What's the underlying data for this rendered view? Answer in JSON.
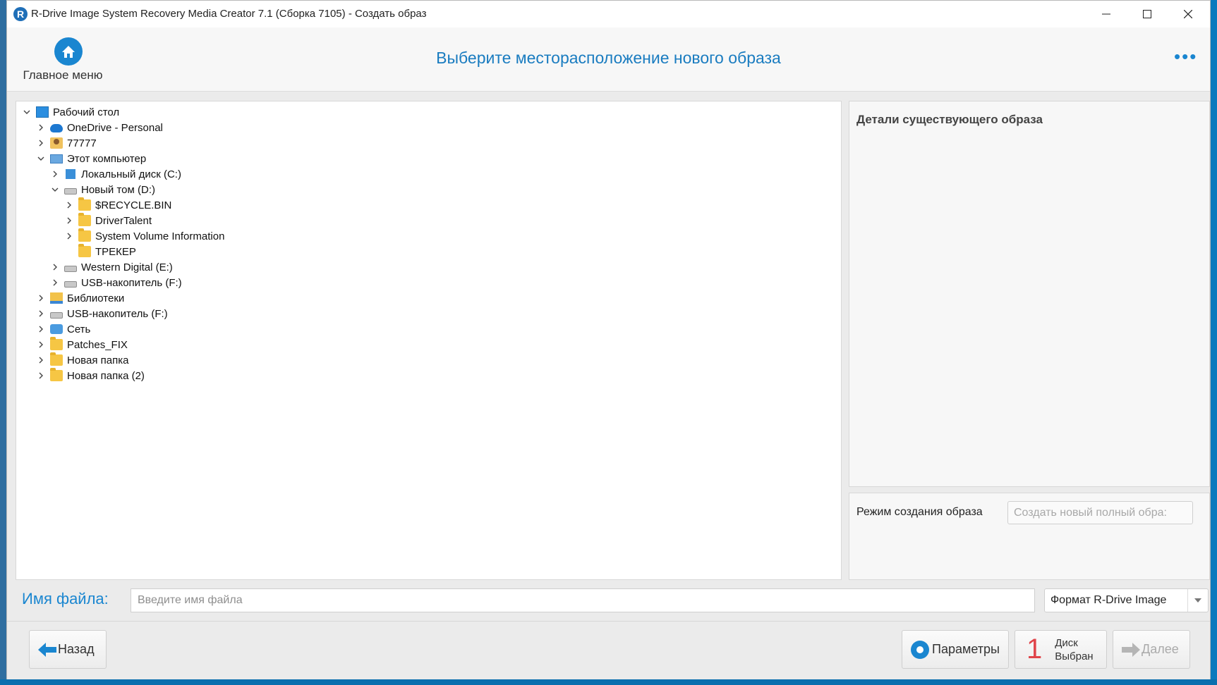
{
  "window": {
    "title": "R-Drive Image System Recovery Media Creator 7.1 (Сборка 7105) - Создать образ",
    "minimize_icon": "minimize-icon",
    "maximize_icon": "maximize-icon",
    "close_icon": "close-icon"
  },
  "header": {
    "home_label": "Главное меню",
    "heading": "Выберите месторасположение нового образа",
    "more": "•••"
  },
  "tree": {
    "items": [
      {
        "label": "Рабочий стол",
        "expanded": true,
        "icon": "desktop-icon"
      },
      {
        "label": "OneDrive - Personal",
        "expanded": false,
        "icon": "cloud-icon"
      },
      {
        "label": "77777",
        "expanded": false,
        "icon": "user-folder-icon"
      },
      {
        "label": "Этот компьютер",
        "expanded": true,
        "icon": "computer-icon"
      },
      {
        "label": "Локальный диск (C:)",
        "expanded": false,
        "icon": "windows-drive-icon"
      },
      {
        "label": "Новый том (D:)",
        "expanded": true,
        "icon": "drive-icon"
      },
      {
        "label": "$RECYCLE.BIN",
        "expanded": false,
        "icon": "folder-icon"
      },
      {
        "label": "DriverTalent",
        "expanded": false,
        "icon": "folder-icon"
      },
      {
        "label": "System Volume Information",
        "expanded": false,
        "icon": "folder-icon"
      },
      {
        "label": "ТРЕКЕР",
        "expanded": null,
        "icon": "folder-icon"
      },
      {
        "label": "Western Digital (E:)",
        "expanded": false,
        "icon": "drive-icon"
      },
      {
        "label": "USB-накопитель (F:)",
        "expanded": false,
        "icon": "drive-icon"
      },
      {
        "label": "Библиотеки",
        "expanded": false,
        "icon": "library-icon"
      },
      {
        "label": "USB-накопитель (F:)",
        "expanded": false,
        "icon": "drive-icon"
      },
      {
        "label": "Сеть",
        "expanded": false,
        "icon": "network-icon"
      },
      {
        "label": "Patches_FIX",
        "expanded": false,
        "icon": "folder-icon"
      },
      {
        "label": "Новая папка",
        "expanded": false,
        "icon": "folder-icon"
      },
      {
        "label": "Новая папка (2)",
        "expanded": false,
        "icon": "folder-icon"
      }
    ]
  },
  "details": {
    "title": "Детали существующего образа"
  },
  "mode": {
    "label": "Режим создания образа",
    "value": "Создать новый полный обра:"
  },
  "file": {
    "label": "Имя файла:",
    "value": "",
    "placeholder": "Введите имя файла",
    "format": "Формат R-Drive Image"
  },
  "buttons": {
    "back": "Назад",
    "params": "Параметры",
    "disk_count": "1",
    "disk_line1": "Диск",
    "disk_line2": "Выбран",
    "next": "Далее"
  },
  "colors": {
    "accent": "#1a86d0",
    "heading": "#1a7cc0",
    "disk_count": "#e0444a"
  }
}
